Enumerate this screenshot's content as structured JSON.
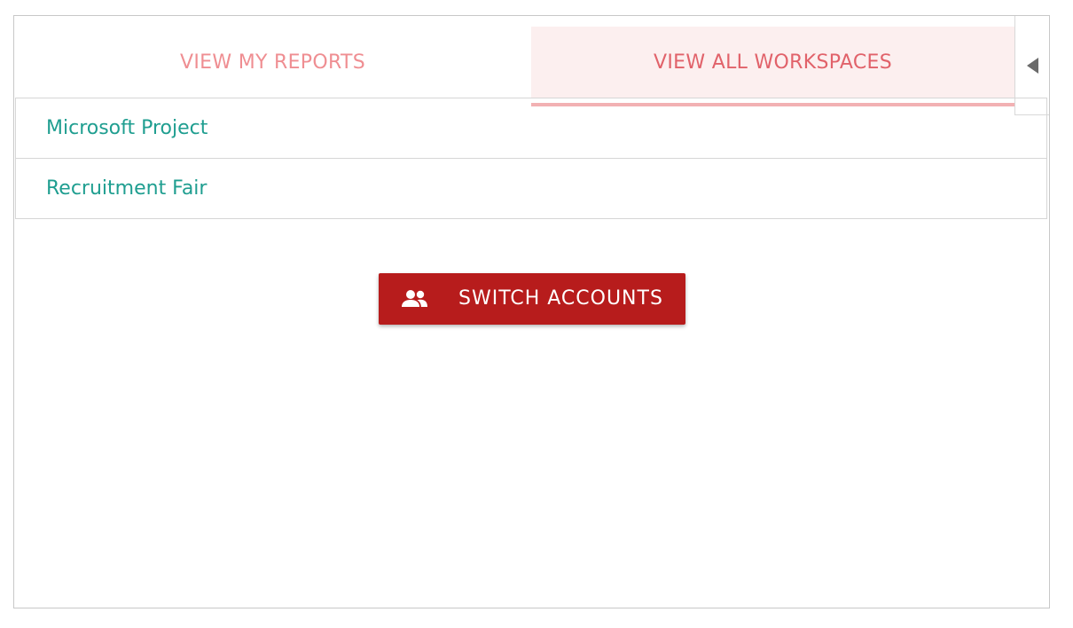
{
  "tabs": {
    "reports_label": "VIEW MY REPORTS",
    "workspaces_label": "VIEW ALL WORKSPACES",
    "active": "workspaces"
  },
  "workspaces": [
    {
      "name": "Microsoft Project"
    },
    {
      "name": "Recruitment Fair"
    }
  ],
  "switch_button": {
    "label": "SWITCH ACCOUNTS",
    "icon": "people-icon"
  },
  "collapse_button": {
    "icon": "caret-left-icon"
  },
  "colors": {
    "accent": "#b71c1c",
    "tab_inactive_text": "#ef8e92",
    "tab_active_text": "#e1626a",
    "tab_active_bg": "#fcefef",
    "link_text": "#1f9e90"
  }
}
